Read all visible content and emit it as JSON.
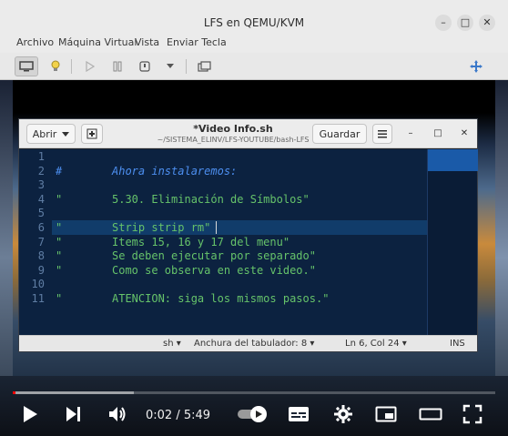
{
  "window": {
    "title": "LFS en QEMU/KVM",
    "menu": [
      "Archivo",
      "Máquina Virtual",
      "Vista",
      "Enviar Tecla"
    ]
  },
  "gedit": {
    "open_label": "Abrir",
    "title": "*Video Info.sh",
    "path": "~/SISTEMA_ELINV/LFS-YOUTUBE/bash-LFS",
    "save_label": "Guardar",
    "lines": [
      {
        "n": "1",
        "mark": "",
        "text": ""
      },
      {
        "n": "2",
        "mark": "#",
        "text": "Ahora instalaremos:"
      },
      {
        "n": "3",
        "mark": "",
        "text": ""
      },
      {
        "n": "4",
        "mark": "\"",
        "text": "5.30. Eliminación de Símbolos\""
      },
      {
        "n": "5",
        "mark": "",
        "text": ""
      },
      {
        "n": "6",
        "mark": "\"",
        "text": "Strip strip rm\""
      },
      {
        "n": "7",
        "mark": "\"",
        "text": "Items 15, 16 y 17 del menu\""
      },
      {
        "n": "8",
        "mark": "\"",
        "text": "Se deben ejecutar por separado\""
      },
      {
        "n": "9",
        "mark": "\"",
        "text": "Como se observa en este video.\""
      },
      {
        "n": "10",
        "mark": "",
        "text": ""
      },
      {
        "n": "11",
        "mark": "\"",
        "text": "ATENCION: siga los mismos pasos.\""
      }
    ],
    "status": {
      "language": "sh",
      "tab_width": "Anchura del tabulador: 8",
      "position": "Ln 6, Col 24",
      "mode": "INS"
    }
  },
  "player": {
    "current_time": "0:02",
    "separator": " / ",
    "duration": "5:49",
    "progress_fraction": 0.006,
    "buffer_fraction": 0.25
  },
  "colors": {
    "editor_bg": "#0c2240",
    "comment": "#4d8ff0",
    "string": "#66c36a",
    "progress": "#ff0000"
  }
}
